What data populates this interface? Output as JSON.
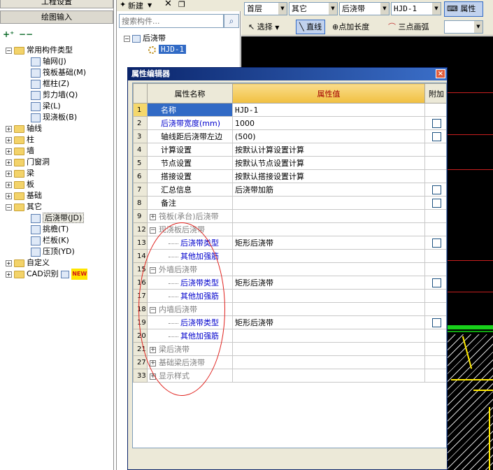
{
  "left_panel": {
    "tab_project": "工程设置",
    "tab_drawing": "绘图输入",
    "tree": [
      {
        "label": "常用构件类型",
        "level": 0,
        "expanded": true,
        "folder": true
      },
      {
        "label": "轴网(J)",
        "level": 1,
        "icon": "grid-icon"
      },
      {
        "label": "筏板基础(M)",
        "level": 1,
        "icon": "raft-foundation-icon"
      },
      {
        "label": "框柱(Z)",
        "level": 1,
        "icon": "column-icon"
      },
      {
        "label": "剪力墙(Q)",
        "level": 1,
        "icon": "shear-wall-icon"
      },
      {
        "label": "梁(L)",
        "level": 1,
        "icon": "beam-icon"
      },
      {
        "label": "现浇板(B)",
        "level": 1,
        "icon": "slab-icon"
      },
      {
        "label": "轴线",
        "level": 0,
        "expanded": false,
        "folder": true
      },
      {
        "label": "柱",
        "level": 0,
        "expanded": false,
        "folder": true
      },
      {
        "label": "墙",
        "level": 0,
        "expanded": false,
        "folder": true
      },
      {
        "label": "门窗洞",
        "level": 0,
        "expanded": false,
        "folder": true
      },
      {
        "label": "梁",
        "level": 0,
        "expanded": false,
        "folder": true
      },
      {
        "label": "板",
        "level": 0,
        "expanded": false,
        "folder": true
      },
      {
        "label": "基础",
        "level": 0,
        "expanded": false,
        "folder": true
      },
      {
        "label": "其它",
        "level": 0,
        "expanded": true,
        "folder": true
      },
      {
        "label": "后浇带(JD)",
        "level": 1,
        "icon": "post-pour-strip-icon",
        "selected": true
      },
      {
        "label": "挑檐(T)",
        "level": 1,
        "icon": "eave-icon"
      },
      {
        "label": "栏板(K)",
        "level": 1,
        "icon": "parapet-icon"
      },
      {
        "label": "压顶(YD)",
        "level": 1,
        "icon": "coping-icon"
      },
      {
        "label": "自定义",
        "level": 0,
        "expanded": false,
        "folder": true
      },
      {
        "label": "CAD识别",
        "level": 0,
        "expanded": false,
        "folder": true,
        "badge": "NEW"
      }
    ]
  },
  "mid_panel": {
    "new_label": "新建",
    "search_placeholder": "搜索构件...",
    "root_label": "后浇带",
    "child_label": "HJD-1"
  },
  "main_toolbar": {
    "floor": "首层",
    "category": "其它",
    "type": "后浇带",
    "component": "HJD-1",
    "properties_label": "属性",
    "select_label": "选择",
    "line_label": "直线",
    "point_length_label": "点加长度",
    "three_point_arc_label": "三点画弧"
  },
  "property_editor": {
    "title": "属性编辑器",
    "col_name": "属性名称",
    "col_value": "属性值",
    "col_add": "附加",
    "rows": [
      {
        "num": "1",
        "name": "名称",
        "value": "HJD-1",
        "style": "normal",
        "selected": true,
        "check": false
      },
      {
        "num": "2",
        "name": "后浇带宽度(mm)",
        "value": "1000",
        "style": "blue",
        "check": true
      },
      {
        "num": "3",
        "name": "轴线距后浇带左边",
        "value": "(500)",
        "style": "normal",
        "check": true
      },
      {
        "num": "4",
        "name": "计算设置",
        "value": "按默认计算设置计算",
        "style": "normal",
        "check": false
      },
      {
        "num": "5",
        "name": "节点设置",
        "value": "按默认节点设置计算",
        "style": "normal",
        "check": false
      },
      {
        "num": "6",
        "name": "搭接设置",
        "value": "按默认搭接设置计算",
        "style": "normal",
        "check": false
      },
      {
        "num": "7",
        "name": "汇总信息",
        "value": "后浇带加筋",
        "style": "normal",
        "check": true
      },
      {
        "num": "8",
        "name": "备注",
        "value": "",
        "style": "normal",
        "check": true
      },
      {
        "num": "9",
        "name": "筏板(承台)后浇带",
        "value": "",
        "style": "group-collapsed",
        "check": false
      },
      {
        "num": "12",
        "name": "现浇板后浇带",
        "value": "",
        "style": "group-expanded",
        "check": false
      },
      {
        "num": "13",
        "name": "后浇带类型",
        "value": "矩形后浇带",
        "style": "sub",
        "check": true
      },
      {
        "num": "14",
        "name": "其他加强筋",
        "value": "",
        "style": "sub",
        "check": false
      },
      {
        "num": "15",
        "name": "外墙后浇带",
        "value": "",
        "style": "group-expanded",
        "check": false
      },
      {
        "num": "16",
        "name": "后浇带类型",
        "value": "矩形后浇带",
        "style": "sub",
        "check": true
      },
      {
        "num": "17",
        "name": "其他加强筋",
        "value": "",
        "style": "sub",
        "check": false
      },
      {
        "num": "18",
        "name": "内墙后浇带",
        "value": "",
        "style": "group-expanded",
        "check": false
      },
      {
        "num": "19",
        "name": "后浇带类型",
        "value": "矩形后浇带",
        "style": "sub",
        "check": true
      },
      {
        "num": "20",
        "name": "其他加强筋",
        "value": "",
        "style": "sub",
        "check": false
      },
      {
        "num": "21",
        "name": "梁后浇带",
        "value": "",
        "style": "group-collapsed",
        "check": false
      },
      {
        "num": "27",
        "name": "基础梁后浇带",
        "value": "",
        "style": "group-collapsed",
        "check": false
      },
      {
        "num": "33",
        "name": "显示样式",
        "value": "",
        "style": "group-collapsed",
        "check": false
      }
    ]
  },
  "colors": {
    "selection": "#316ac5",
    "header_value_bg": "#f1c040",
    "annotation_red": "#e0201c",
    "canvas": "#000000"
  }
}
